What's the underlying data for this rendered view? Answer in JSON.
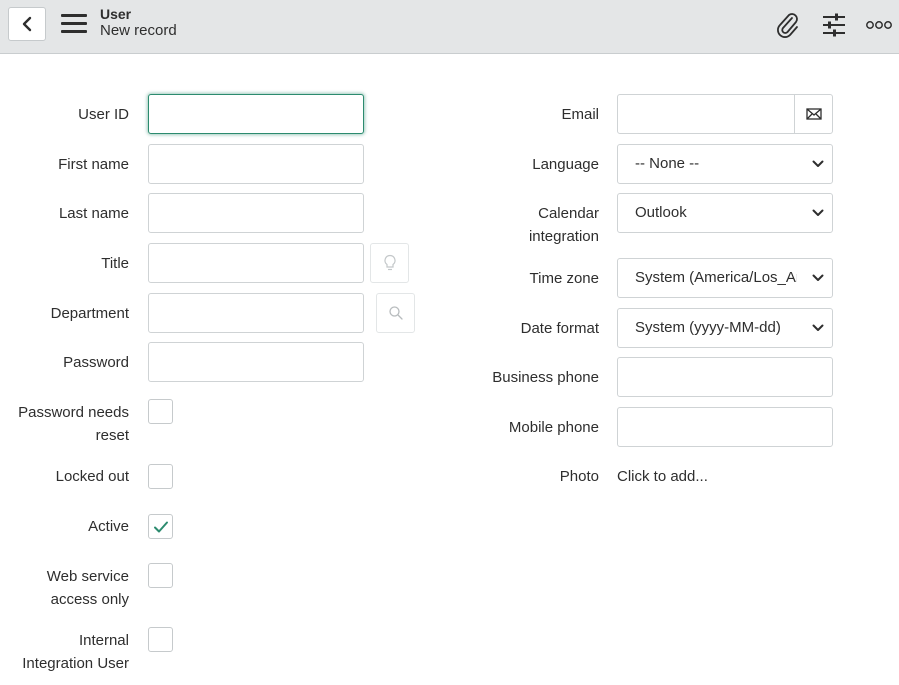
{
  "header": {
    "title": "User",
    "subtitle": "New record"
  },
  "left_fields": {
    "user_id": {
      "label": "User ID",
      "value": ""
    },
    "first_name": {
      "label": "First name",
      "value": ""
    },
    "last_name": {
      "label": "Last name",
      "value": ""
    },
    "title": {
      "label": "Title",
      "value": ""
    },
    "department": {
      "label": "Department",
      "value": ""
    },
    "password": {
      "label": "Password",
      "value": ""
    },
    "password_needs_reset": {
      "label_line1": "Password needs",
      "label_line2": "reset",
      "checked": false
    },
    "locked_out": {
      "label": "Locked out",
      "checked": false
    },
    "active": {
      "label": "Active",
      "checked": true
    },
    "web_service_access_only": {
      "label_line1": "Web service",
      "label_line2": "access only",
      "checked": false
    },
    "internal_integration_user": {
      "label_line1": "Internal",
      "label_line2": "Integration User",
      "checked": false
    }
  },
  "right_fields": {
    "email": {
      "label": "Email",
      "value": ""
    },
    "language": {
      "label": "Language",
      "value": "-- None --"
    },
    "calendar_integration": {
      "label_line1": "Calendar",
      "label_line2": "integration",
      "value": "Outlook"
    },
    "time_zone": {
      "label": "Time zone",
      "value": "System (America/Los_Angeles)"
    },
    "date_format": {
      "label": "Date format",
      "value": "System (yyyy-MM-dd)"
    },
    "business_phone": {
      "label": "Business phone",
      "value": ""
    },
    "mobile_phone": {
      "label": "Mobile phone",
      "value": ""
    },
    "photo": {
      "label": "Photo",
      "link": "Click to add..."
    }
  },
  "icons": {
    "back": "chevron-left-icon",
    "menu": "hamburger-menu-icon",
    "attachment": "paperclip-icon",
    "settings": "sliders-icon",
    "more": "more-options-icon",
    "lookup_title": "lightbulb-icon",
    "lookup_department": "search-icon",
    "email_action": "envelope-icon",
    "select_arrow": "chevron-down-icon",
    "checkmark": "checkmark-icon"
  },
  "colors": {
    "header_bg": "#e4e6e7",
    "focus_border": "#2c8b6f",
    "check_color": "#2c8b6f"
  }
}
